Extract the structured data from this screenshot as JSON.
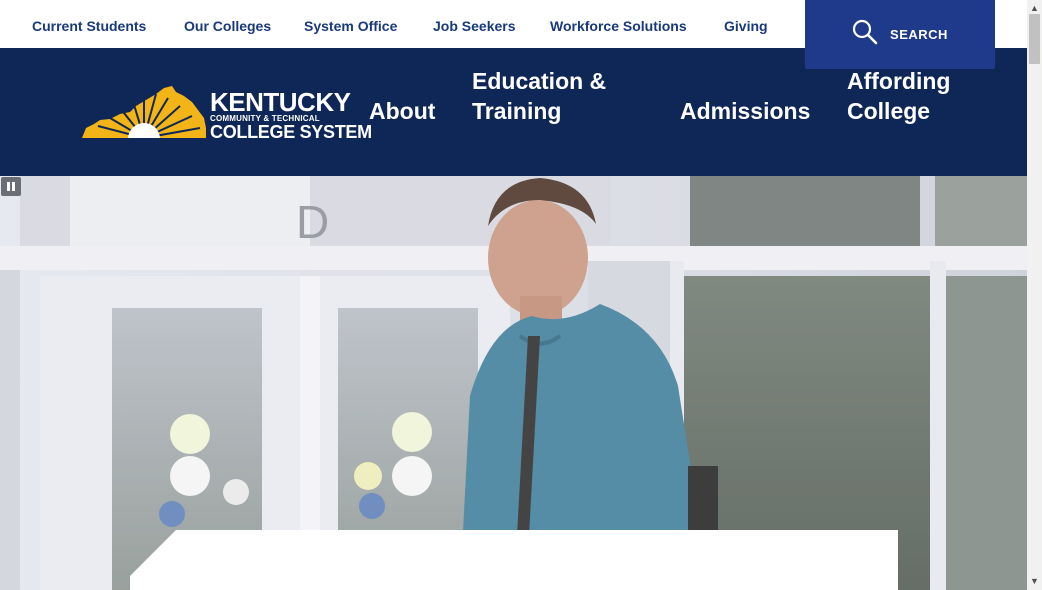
{
  "utility_nav": {
    "items": [
      "Current Students",
      "Our Colleges",
      "System Office",
      "Job Seekers",
      "Workforce Solutions",
      "Giving"
    ]
  },
  "search": {
    "label": "SEARCH",
    "icon": "search-icon"
  },
  "logo": {
    "line1": "KENTUCKY",
    "line2": "COMMUNITY & TECHNICAL",
    "line3": "COLLEGE SYSTEM",
    "icon": "sunburst-kentucky-logo"
  },
  "main_nav": {
    "items": [
      {
        "line1": "About",
        "line2": ""
      },
      {
        "line1": "Education &",
        "line2": "Training"
      },
      {
        "line1": "Admissions",
        "line2": ""
      },
      {
        "line1": "Affording",
        "line2": "College"
      }
    ]
  },
  "hero": {
    "door_letter": "D",
    "pause_icon": "pause-icon"
  },
  "colors": {
    "navy": "#0f2757",
    "search_blue": "#1f3a8a",
    "link_blue": "#183a7a",
    "gold": "#f2b416"
  }
}
